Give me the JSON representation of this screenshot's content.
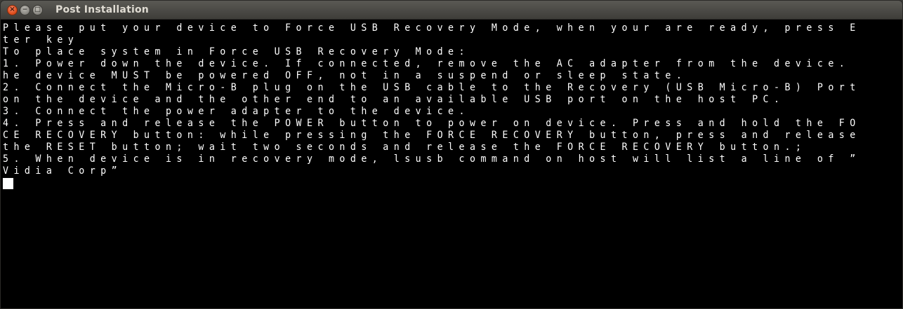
{
  "window": {
    "title": "Post Installation",
    "close_glyph": "×",
    "min_glyph": "−",
    "max_glyph": "□"
  },
  "terminal": {
    "lines": [
      "Please put your device to Force USB Recovery Mode, when your are ready, press En",
      "ter key",
      "To place system in Force USB Recovery Mode:",
      "1. Power down the device. If connected, remove the AC adapter from the device. T",
      "he device MUST be powered OFF, not in a suspend or sleep state.",
      "2. Connect the Micro-B plug on the USB cable to the Recovery (USB Micro-B) Port",
      "on the device and the other end to an available USB port on the host PC.",
      "3. Connect the power adapter to the device.",
      "4. Press and release the POWER button to power on device. Press and hold the FOR",
      "CE RECOVERY button: while pressing the FORCE RECOVERY button, press and release",
      "the RESET button; wait two seconds and release the FORCE RECOVERY button.;",
      "5. When device is in recovery mode, lsusb command on host will list a line of ”N",
      "Vidia Corp”"
    ]
  },
  "colors": {
    "terminal_background": "#000000",
    "terminal_text": "#ffffff",
    "titlebar": "#3e3d39",
    "close_button": "#e0501f"
  }
}
